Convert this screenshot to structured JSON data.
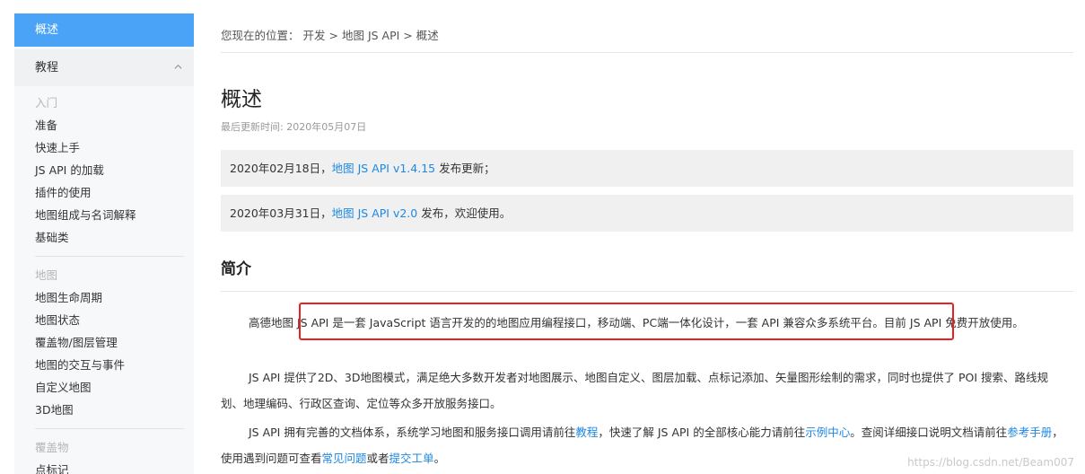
{
  "sidebar": {
    "active_item": "概述",
    "section": "教程",
    "groups": [
      {
        "title": "入门",
        "items": [
          "准备",
          "快速上手",
          "JS API 的加载",
          "插件的使用",
          "地图组成与名词解释",
          "基础类"
        ]
      },
      {
        "title": "地图",
        "items": [
          "地图生命周期",
          "地图状态",
          "覆盖物/图层管理",
          "地图的交互与事件",
          "自定义地图",
          "3D地图"
        ]
      },
      {
        "title": "覆盖物",
        "items": [
          "点标记"
        ]
      }
    ]
  },
  "breadcrumb": {
    "prefix": "您现在的位置：",
    "items": [
      "开发",
      "地图 JS API",
      "概述"
    ],
    "separator": ">"
  },
  "page": {
    "title": "概述",
    "updated": "最后更新时间: 2020年05月07日"
  },
  "notices": [
    {
      "prefix": "2020年02月18日，",
      "link": "地图 JS API v1.4.15",
      "suffix": " 发布更新；"
    },
    {
      "prefix": "2020年03月31日，",
      "link": "地图 JS API v2.0",
      "suffix": " 发布，欢迎使用。"
    }
  ],
  "intro": {
    "title": "简介",
    "p1": "高德地图 JS API 是一套 JavaScript 语言开发的的地图应用编程接口，移动端、PC端一体化设计，一套 API 兼容众多系统平台。目前 JS API 免费开放使用。",
    "p2": "JS API 提供了2D、3D地图模式，满足绝大多数开发者对地图展示、地图自定义、图层加载、点标记添加、矢量图形绘制的需求，同时也提供了 POI 搜索、路线规划、地理编码、行政区查询、定位等众多开放服务接口。",
    "p3": {
      "t1": "JS API 拥有完善的文档体系，系统学习地图和服务接口调用请前往",
      "l1": "教程",
      "t2": "，快速了解 JS API 的全部核心能力请前往",
      "l2": "示例中心",
      "t3": "。查阅详细接口说明文档请前往",
      "l3": "参考手册",
      "t4": "，使用遇到问题可查看",
      "l4": "常见问题",
      "t5": "或者",
      "l5": "提交工单",
      "t6": "。"
    }
  },
  "watermark": "https://blog.csdn.net/Beam007",
  "colors": {
    "accent": "#4ba3f7",
    "link": "#1e88e5",
    "highlight": "#e8201f"
  }
}
